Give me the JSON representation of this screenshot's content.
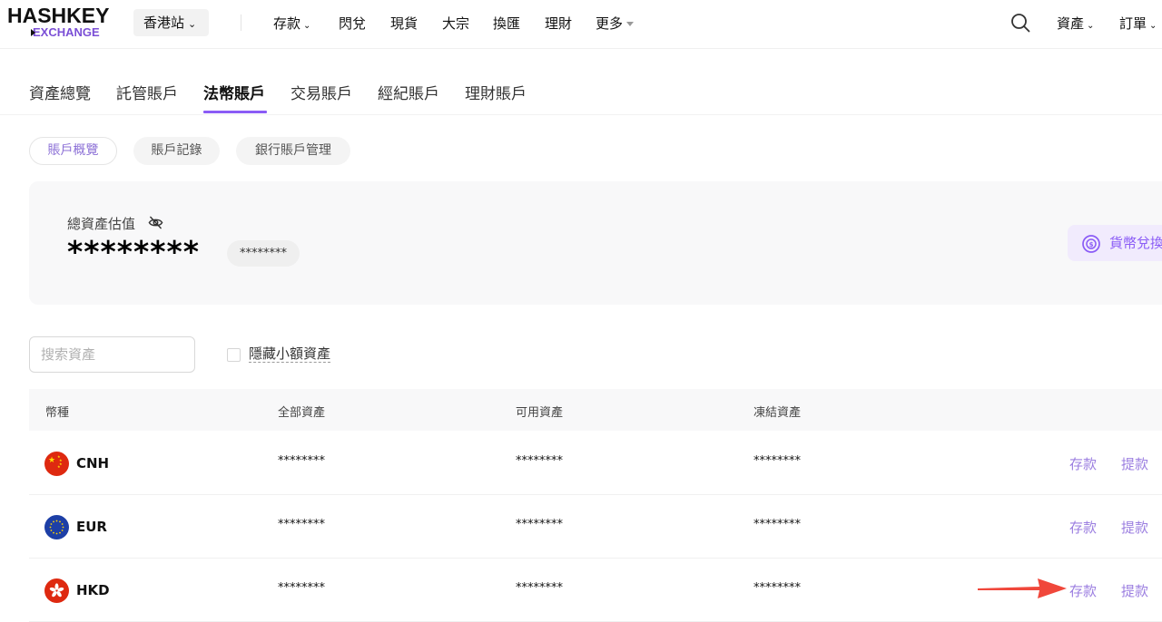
{
  "header": {
    "logo_top": "HASHKEY",
    "logo_bottom": "EXCHANGE",
    "site": "香港站",
    "nav": [
      "存款",
      "閃兌",
      "現貨",
      "大宗",
      "換匯",
      "理財",
      "更多"
    ],
    "right": [
      "資產",
      "訂單"
    ]
  },
  "account_tabs": [
    "資產總覽",
    "託管賬戶",
    "法幣賬戶",
    "交易賬戶",
    "經紀賬戶",
    "理財賬戶"
  ],
  "sub_tabs": [
    "賬戶概覽",
    "賬戶記錄",
    "銀行賬戶管理"
  ],
  "summary": {
    "label": "總資產估值",
    "value": "********",
    "chip": "********",
    "convert_button": "貨幣兌換"
  },
  "filters": {
    "search_placeholder": "搜索資產",
    "hide_small_label": "隱藏小額資產"
  },
  "table": {
    "headers": [
      "幣種",
      "全部資產",
      "可用資產",
      "凍結資產"
    ],
    "rows": [
      {
        "currency": "CNH",
        "total": "********",
        "available": "********",
        "frozen": "********",
        "deposit": "存款",
        "withdraw": "提款"
      },
      {
        "currency": "EUR",
        "total": "********",
        "available": "********",
        "frozen": "********",
        "deposit": "存款",
        "withdraw": "提款"
      },
      {
        "currency": "HKD",
        "total": "********",
        "available": "********",
        "frozen": "********",
        "deposit": "存款",
        "withdraw": "提款"
      }
    ]
  },
  "colors": {
    "accent": "#8b5cf6",
    "link": "#9b7ee0",
    "arrow": "#f0473b"
  }
}
